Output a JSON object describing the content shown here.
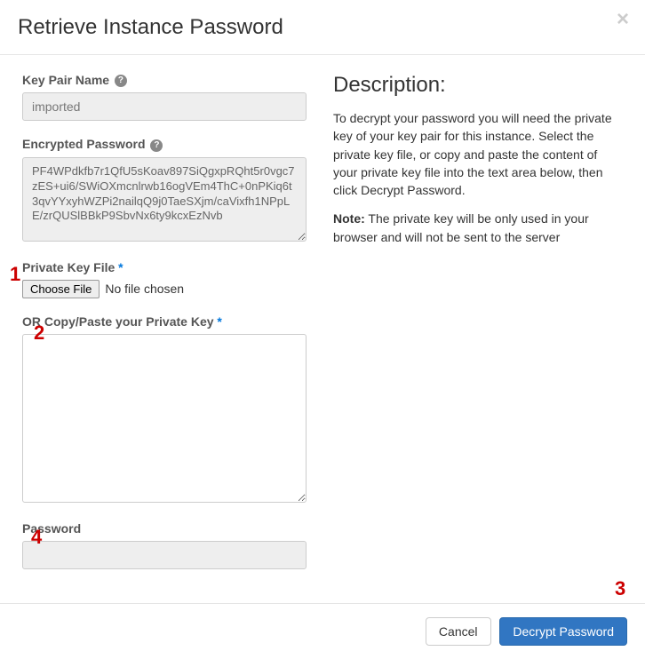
{
  "modal": {
    "title": "Retrieve Instance Password"
  },
  "form": {
    "key_pair_label": "Key Pair Name",
    "key_pair_value": "imported",
    "encrypted_label": "Encrypted Password",
    "encrypted_value": "PF4WPdkfb7r1QfU5sKoav897SiQgxpRQht5r0vgc7zES+ui6/SWiOXmcnlrwb16ogVEm4ThC+0nPKiq6t3qvYYxyhWZPi2nailqQ9j0TaeSXjm/caVixfh1NPpLE/zrQUSlBBkP9SbvNx6ty9kcxEzNvb",
    "private_file_label": "Private Key File",
    "choose_file_label": "Choose File",
    "no_file_text": "No file chosen",
    "paste_key_label": "OR Copy/Paste your Private Key",
    "password_label": "Password"
  },
  "description": {
    "heading": "Description:",
    "para1": "To decrypt your password you will need the private key of your key pair for this instance. Select the private key file, or copy and paste the content of your private key file into the text area below, then click Decrypt Password.",
    "note_label": "Note:",
    "note_text": " The private key will be only used in your browser and will not be sent to the server"
  },
  "footer": {
    "cancel_label": "Cancel",
    "submit_label": "Decrypt Password"
  },
  "callouts": {
    "one": "1",
    "two": "2",
    "three": "3",
    "four": "4"
  }
}
